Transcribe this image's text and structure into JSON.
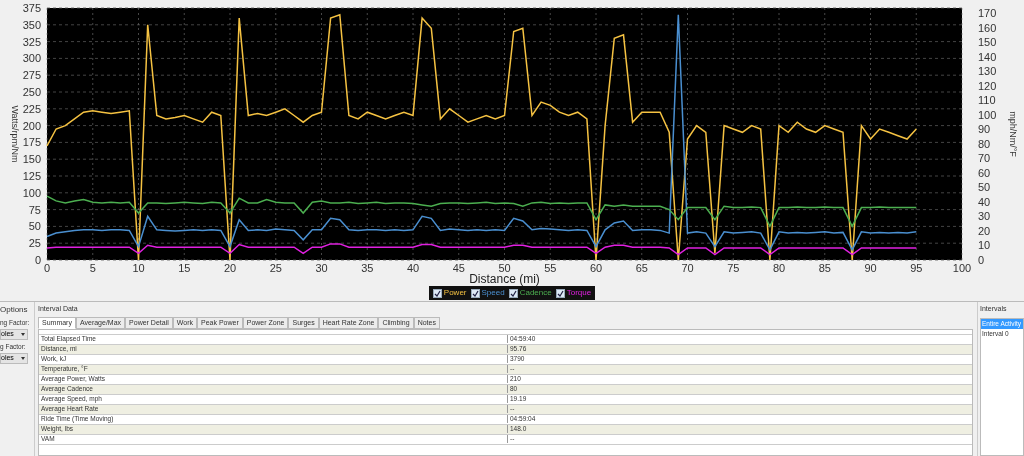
{
  "chart": {
    "chart_data": {
      "type": "line",
      "grid": true,
      "xlabel": "Distance (mi)",
      "ylabel": "Watts/rpm/Nm",
      "xlim": [
        0,
        100
      ],
      "ylim": [
        0,
        375
      ],
      "xticks": [
        0,
        5,
        10,
        15,
        20,
        25,
        30,
        35,
        40,
        45,
        50,
        55,
        60,
        65,
        70,
        75,
        80,
        85,
        90,
        95,
        100
      ],
      "yticks": [
        0,
        25,
        50,
        75,
        100,
        125,
        150,
        175,
        200,
        225,
        250,
        275,
        300,
        325,
        350,
        375
      ],
      "x": [
        0,
        1,
        2,
        3,
        4,
        5,
        6,
        7,
        8,
        9,
        10,
        11,
        12,
        13,
        14,
        15,
        16,
        17,
        18,
        19,
        20,
        21,
        22,
        23,
        24,
        25,
        26,
        27,
        28,
        29,
        30,
        31,
        32,
        33,
        34,
        35,
        36,
        37,
        38,
        39,
        40,
        41,
        42,
        43,
        44,
        45,
        46,
        47,
        48,
        49,
        50,
        51,
        52,
        53,
        54,
        55,
        56,
        57,
        58,
        59,
        60,
        61,
        62,
        63,
        64,
        65,
        66,
        67,
        68,
        69,
        70,
        71,
        72,
        73,
        74,
        75,
        76,
        77,
        78,
        79,
        80,
        81,
        82,
        83,
        84,
        85,
        86,
        87,
        88,
        89,
        90,
        91,
        92,
        93,
        94,
        95
      ],
      "series": [
        {
          "name": "Power",
          "color": "#f5c242",
          "values": [
            170,
            195,
            200,
            210,
            220,
            222,
            220,
            218,
            220,
            222,
            0,
            350,
            215,
            210,
            212,
            215,
            210,
            205,
            220,
            215,
            0,
            360,
            215,
            218,
            215,
            220,
            225,
            215,
            205,
            215,
            220,
            360,
            365,
            215,
            210,
            220,
            215,
            210,
            215,
            220,
            215,
            360,
            345,
            210,
            225,
            215,
            205,
            210,
            215,
            210,
            215,
            340,
            345,
            215,
            235,
            230,
            220,
            215,
            220,
            210,
            0,
            200,
            330,
            335,
            205,
            220,
            220,
            220,
            190,
            0,
            180,
            200,
            190,
            10,
            200,
            195,
            190,
            200,
            195,
            0,
            200,
            190,
            205,
            195,
            190,
            200,
            195,
            190,
            0,
            200,
            180,
            195,
            190,
            185,
            180,
            195
          ]
        },
        {
          "name": "Speed",
          "color": "#4a8fd0",
          "values": [
            35,
            40,
            42,
            44,
            45,
            45,
            44,
            45,
            45,
            44,
            20,
            65,
            45,
            44,
            43,
            44,
            45,
            44,
            45,
            44,
            20,
            60,
            44,
            45,
            44,
            46,
            45,
            44,
            30,
            45,
            45,
            62,
            60,
            45,
            44,
            45,
            45,
            44,
            45,
            44,
            45,
            65,
            62,
            44,
            46,
            45,
            44,
            45,
            44,
            45,
            44,
            62,
            58,
            45,
            47,
            46,
            45,
            44,
            45,
            44,
            20,
            45,
            55,
            58,
            44,
            45,
            45,
            44,
            40,
            365,
            40,
            42,
            40,
            20,
            42,
            40,
            41,
            42,
            40,
            15,
            42,
            40,
            41,
            40,
            41,
            42,
            40,
            41,
            15,
            42,
            40,
            41,
            40,
            41,
            40,
            42
          ]
        },
        {
          "name": "Cadence",
          "color": "#4caf50",
          "values": [
            95,
            88,
            85,
            88,
            90,
            86,
            85,
            86,
            85,
            86,
            70,
            85,
            85,
            84,
            85,
            86,
            85,
            84,
            86,
            85,
            70,
            92,
            85,
            85,
            90,
            86,
            85,
            85,
            70,
            86,
            88,
            85,
            85,
            86,
            84,
            85,
            86,
            84,
            85,
            85,
            84,
            82,
            80,
            84,
            85,
            85,
            84,
            85,
            86,
            84,
            85,
            84,
            80,
            85,
            86,
            84,
            85,
            84,
            85,
            85,
            60,
            82,
            80,
            82,
            80,
            80,
            80,
            80,
            75,
            60,
            78,
            78,
            78,
            60,
            80,
            78,
            78,
            79,
            78,
            50,
            78,
            78,
            79,
            78,
            78,
            79,
            78,
            78,
            50,
            78,
            78,
            79,
            78,
            78,
            78,
            78
          ]
        },
        {
          "name": "Torque",
          "color": "#e020e0",
          "values": [
            18,
            19,
            19,
            19,
            19,
            19,
            19,
            19,
            19,
            19,
            10,
            22,
            19,
            19,
            19,
            19,
            19,
            19,
            19,
            19,
            10,
            23,
            19,
            19,
            19,
            19,
            19,
            19,
            10,
            19,
            19,
            24,
            24,
            19,
            19,
            19,
            19,
            19,
            19,
            19,
            19,
            23,
            23,
            19,
            19,
            19,
            19,
            19,
            19,
            19,
            19,
            22,
            22,
            19,
            19,
            19,
            19,
            19,
            19,
            19,
            10,
            19,
            22,
            22,
            19,
            19,
            19,
            19,
            18,
            8,
            18,
            18,
            18,
            8,
            18,
            18,
            18,
            18,
            18,
            8,
            18,
            18,
            18,
            18,
            18,
            18,
            18,
            18,
            8,
            18,
            18,
            18,
            18,
            18,
            18,
            18
          ]
        }
      ]
    },
    "right_axis": {
      "label": "mph/Nm/°F",
      "ticks": [
        "170",
        "160",
        "150",
        "140",
        "130",
        "120",
        "110",
        "100",
        "90",
        "80",
        "70",
        "60",
        "50",
        "40",
        "30",
        "20",
        "10",
        "0"
      ]
    },
    "legend": [
      {
        "checked": true
      },
      {
        "checked": true
      },
      {
        "checked": true
      },
      {
        "checked": true
      }
    ]
  },
  "options": {
    "title": "Options",
    "fields": [
      {
        "label": "ng Factor:",
        "value": "oles"
      },
      {
        "label": "g Factor:",
        "value": "oles"
      }
    ]
  },
  "interval_data": {
    "title": "Interval Data",
    "tabs": [
      {
        "label": "Summary",
        "selected": true
      },
      {
        "label": "Average/Max",
        "selected": false
      },
      {
        "label": "Power Detail",
        "selected": false
      },
      {
        "label": "Work",
        "selected": false
      },
      {
        "label": "Peak Power",
        "selected": false
      },
      {
        "label": "Power Zone",
        "selected": false
      },
      {
        "label": "Surges",
        "selected": false
      },
      {
        "label": "Heart Rate Zone",
        "selected": false
      },
      {
        "label": "Climbing",
        "selected": false
      },
      {
        "label": "Notes",
        "selected": false
      }
    ],
    "rows": [
      {
        "label": "Total Elapsed Time",
        "value": "04:59:40"
      },
      {
        "label": "Distance, mi",
        "value": "95.76"
      },
      {
        "label": "Work, kJ",
        "value": "3790"
      },
      {
        "label": "Temperature, °F",
        "value": "--"
      },
      {
        "label": "Average Power, Watts",
        "value": "210"
      },
      {
        "label": "Average Cadence",
        "value": "80"
      },
      {
        "label": "Average Speed, mph",
        "value": "19.19"
      },
      {
        "label": "Average Heart Rate",
        "value": "--"
      },
      {
        "label": "Ride Time (Time Moving)",
        "value": "04:59:04"
      },
      {
        "label": "Weight, lbs",
        "value": "148.0"
      },
      {
        "label": "VAM",
        "value": "--"
      }
    ]
  },
  "intervals": {
    "title": "Intervals",
    "items": [
      {
        "label": "Entire Activity",
        "selected": true
      },
      {
        "label": "Interval 0",
        "selected": false
      }
    ]
  }
}
